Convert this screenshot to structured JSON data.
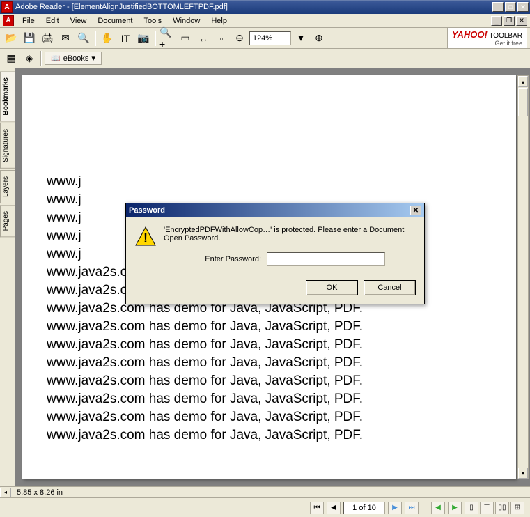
{
  "titlebar": {
    "app": "Adobe Reader",
    "doc": "[ElementAlignJustifiedBOTTOMLEFTPDF.pdf]"
  },
  "menu": {
    "file": "File",
    "edit": "Edit",
    "view": "View",
    "document": "Document",
    "tools": "Tools",
    "window": "Window",
    "help": "Help"
  },
  "toolbar": {
    "zoom": "124%",
    "yahoo_brand": "YAHOO!",
    "yahoo_suffix": " TOOLBAR",
    "yahoo_sub": "Get it free"
  },
  "toolbar2": {
    "ebooks": "eBooks"
  },
  "sidetabs": {
    "bookmarks": "Bookmarks",
    "signatures": "Signatures",
    "layers": "Layers",
    "pages": "Pages"
  },
  "document_text_line": "www.java2s.com has demo for Java, JavaScript, PDF.",
  "document_text_partial": "www.j",
  "document_text_partial2": "www.java2s.com has demo for Java, JavaScript, PDF.",
  "dialog": {
    "title": "Password",
    "message": "'EncryptedPDFWithAllowCop…' is protected.  Please enter a Document Open Password.",
    "label": "Enter Password:",
    "ok": "OK",
    "cancel": "Cancel"
  },
  "status": {
    "dims": "5.85 x 8.26 in",
    "page": "1 of 10"
  }
}
